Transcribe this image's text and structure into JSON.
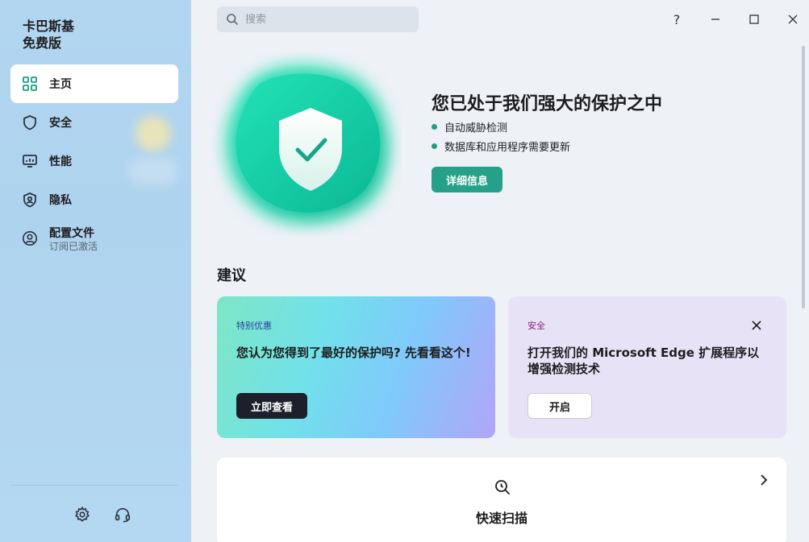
{
  "brand": {
    "line1": "卡巴斯基",
    "line2": "免费版"
  },
  "search": {
    "placeholder": "搜索"
  },
  "sidebar": {
    "items": [
      {
        "label": "主页",
        "icon": "home-grid-icon",
        "active": true
      },
      {
        "label": "安全",
        "icon": "shield-icon"
      },
      {
        "label": "性能",
        "icon": "performance-monitor-icon"
      },
      {
        "label": "隐私",
        "icon": "privacy-shield-person-icon"
      },
      {
        "label": "配置文件",
        "sub": "订阅已激活",
        "icon": "profile-icon"
      }
    ],
    "bottom": {
      "settings_icon": "gear-icon",
      "support_icon": "headset-icon"
    }
  },
  "window_controls": {
    "help": "?",
    "icons": [
      "minimize-icon",
      "maximize-icon",
      "close-icon"
    ]
  },
  "hero": {
    "title": "您已处于我们强大的保护之中",
    "items": [
      "自动威胁检测",
      "数据库和应用程序需要更新"
    ],
    "details_button": "详细信息",
    "colors": {
      "accent": "#25a189",
      "shield_teal": "#16c9a2"
    }
  },
  "recommendations": {
    "title": "建议",
    "cards": [
      {
        "tag": "特别优惠",
        "tag_color": "#2a3f9e",
        "title": "您认为您得到了最好的保护吗? 先看看这个!",
        "button": "立即查看"
      },
      {
        "tag": "安全",
        "tag_color": "#8a1c7c",
        "title": "打开我们的 Microsoft Edge 扩展程序以增强检测技术",
        "button": "开启"
      }
    ]
  },
  "quick_scan": {
    "label": "快速扫描",
    "icon": "scan-magnifier-icon"
  }
}
